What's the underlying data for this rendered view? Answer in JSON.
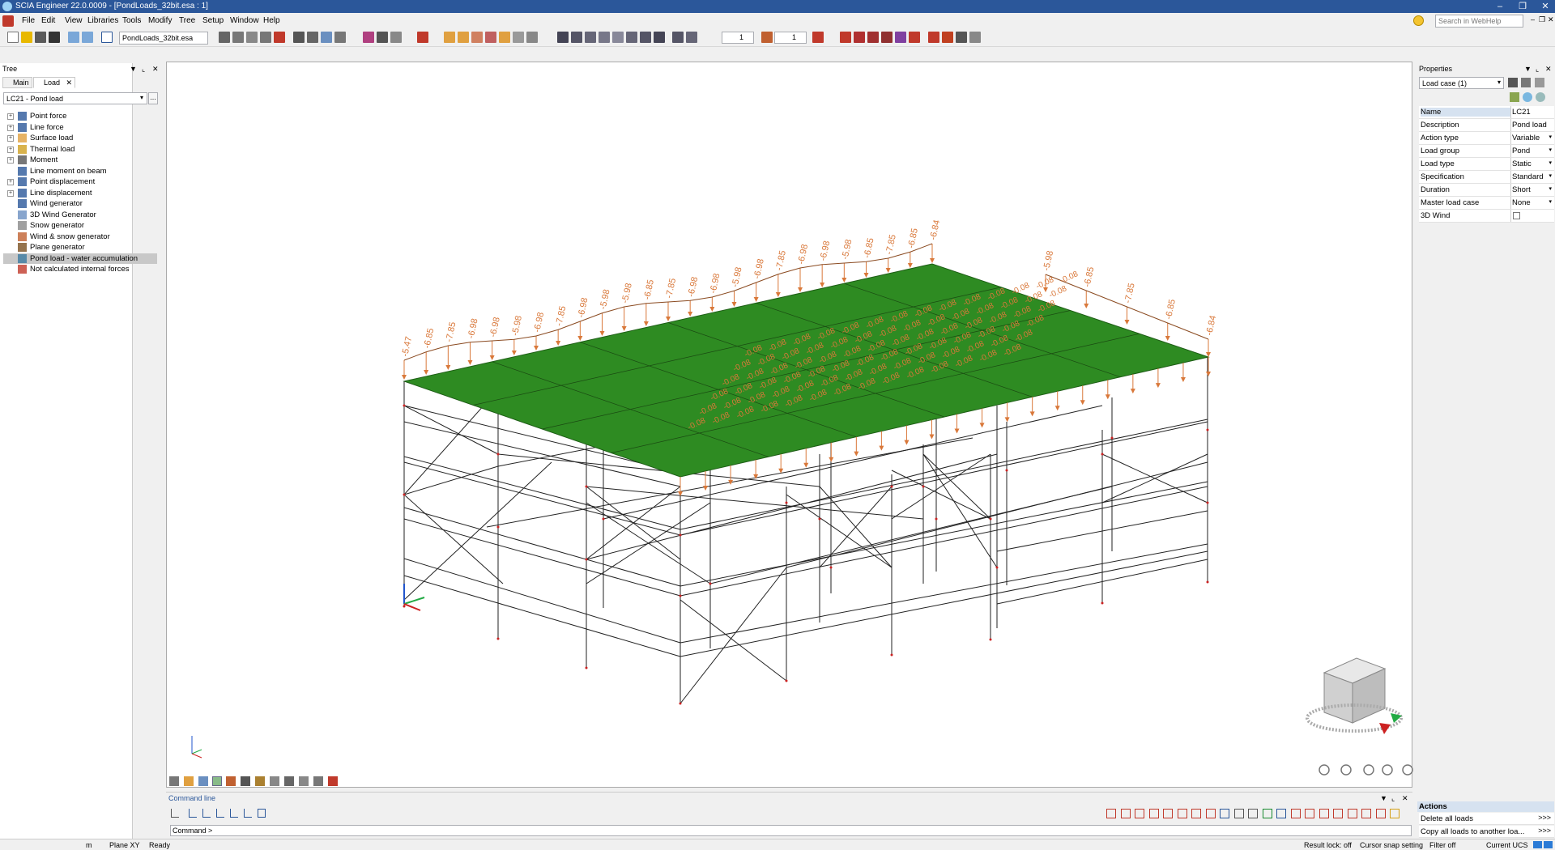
{
  "window": {
    "title": "SCIA Engineer 22.0.0009 - [PondLoads_32bit.esa : 1]"
  },
  "menu": [
    "File",
    "Edit",
    "View",
    "Libraries",
    "Tools",
    "Modify",
    "Tree",
    "Setup",
    "Window",
    "Help"
  ],
  "search": {
    "placeholder": "Search in WebHelp"
  },
  "toolbar": {
    "file_combo": "PondLoads_32bit.esa",
    "spin1": "1",
    "spin2": "1"
  },
  "tree": {
    "title": "Tree",
    "tabs": [
      "Main",
      "Load"
    ],
    "load_case": "LC21 - Pond load",
    "items": [
      {
        "label": "Point force",
        "expand": true
      },
      {
        "label": "Line force",
        "expand": true
      },
      {
        "label": "Surface load",
        "expand": true
      },
      {
        "label": "Thermal load",
        "expand": true
      },
      {
        "label": "Moment",
        "expand": true
      },
      {
        "label": "Line moment on beam",
        "expand": false
      },
      {
        "label": "Point displacement",
        "expand": true
      },
      {
        "label": "Line displacement",
        "expand": true
      },
      {
        "label": "Wind generator",
        "expand": false
      },
      {
        "label": "3D Wind Generator",
        "expand": false
      },
      {
        "label": "Snow generator",
        "expand": false
      },
      {
        "label": "Wind & snow generator",
        "expand": false
      },
      {
        "label": "Plane generator",
        "expand": false
      },
      {
        "label": "Pond load - water accumulation",
        "expand": false
      },
      {
        "label": "Not calculated internal forces",
        "expand": false
      }
    ]
  },
  "properties": {
    "title": "Properties",
    "selector": "Load case (1)",
    "rows": [
      {
        "label": "Name",
        "value": "LC21"
      },
      {
        "label": "Description",
        "value": "Pond load"
      },
      {
        "label": "Action type",
        "value": "Variable"
      },
      {
        "label": "Load group",
        "value": "Pond"
      },
      {
        "label": "Load type",
        "value": "Static"
      },
      {
        "label": "Specification",
        "value": "Standard"
      },
      {
        "label": "Duration",
        "value": "Short"
      },
      {
        "label": "Master load case",
        "value": "None"
      },
      {
        "label": "3D Wind",
        "value": ""
      }
    ]
  },
  "viewport": {
    "front_labels": [
      "-5.47",
      "-6.85",
      "-7.85",
      "-6.98",
      "-6.98",
      "-5.98",
      "-6.98",
      "-7.85",
      "-6.98",
      "-5.98",
      "-5.98",
      "-6.85",
      "-7.85",
      "-6.98",
      "-6.98",
      "-5.98",
      "-6.98",
      "-7.85",
      "-6.98",
      "-6.98",
      "-5.98",
      "-6.85",
      "-7.85",
      "-6.85",
      "-6.84"
    ],
    "side_labels": [
      "-5.98",
      "-6.85",
      "-7.85",
      "-6.85",
      "-6.84"
    ],
    "plane_label": "-0.08"
  },
  "command": {
    "title": "Command line",
    "prompt": "Command >"
  },
  "actions": {
    "title": "Actions",
    "items": [
      {
        "label": "Delete all loads",
        "button": ">>>"
      },
      {
        "label": "Copy all loads to another loa...",
        "button": ">>>"
      }
    ]
  },
  "status": {
    "units": "m",
    "plane": "Plane XY",
    "ready": "Ready",
    "result_lock": "Result lock: off",
    "snap": "Cursor snap setting",
    "filter": "Filter off",
    "ucs": "Current UCS"
  },
  "colors": {
    "accent": "#2b579a",
    "plate": "#2e8b22",
    "load": "#d9783a",
    "node": "#cc2222"
  }
}
